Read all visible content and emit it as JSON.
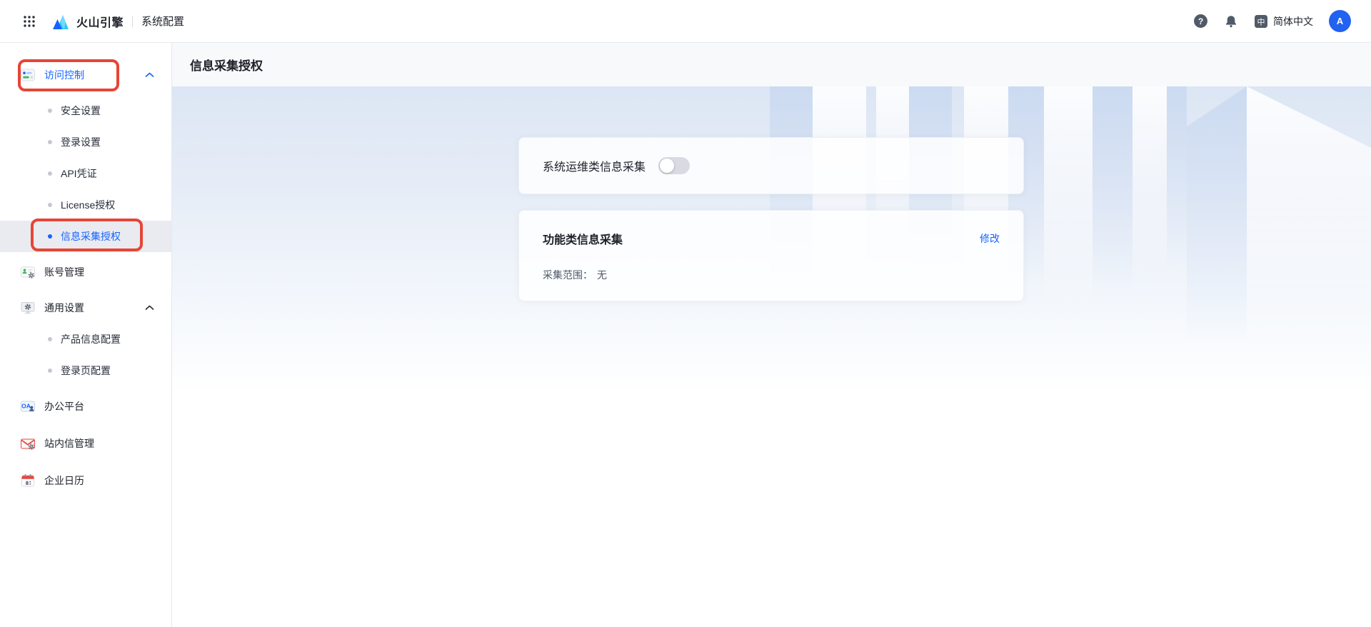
{
  "topbar": {
    "brand": "火山引擎",
    "app_title": "系统配置",
    "language": "简体中文",
    "avatar_letter": "A"
  },
  "sidebar": {
    "items": [
      {
        "label": "访问控制",
        "type": "group",
        "state": "active-expanded",
        "annotated": true
      },
      {
        "label": "安全设置",
        "type": "sub"
      },
      {
        "label": "登录设置",
        "type": "sub"
      },
      {
        "label": "API凭证",
        "type": "sub"
      },
      {
        "label": "License授权",
        "type": "sub"
      },
      {
        "label": "信息采集授权",
        "type": "sub",
        "state": "selected",
        "annotated": true
      },
      {
        "label": "账号管理",
        "type": "group"
      },
      {
        "label": "通用设置",
        "type": "group",
        "state": "expanded"
      },
      {
        "label": "产品信息配置",
        "type": "sub"
      },
      {
        "label": "登录页配置",
        "type": "sub"
      },
      {
        "label": "办公平台",
        "type": "group"
      },
      {
        "label": "站内信管理",
        "type": "group"
      },
      {
        "label": "企业日历",
        "type": "group"
      }
    ]
  },
  "page": {
    "title": "信息采集授权"
  },
  "main": {
    "cards": [
      {
        "title": "系统运维类信息采集",
        "toggle_state": "off"
      },
      {
        "title": "功能类信息采集",
        "action_label": "修改",
        "scope_label": "采集范围：",
        "scope_value": "无"
      }
    ]
  },
  "colors": {
    "accent": "#1664ff",
    "annotation_red": "#e64536",
    "topbar_icon_gray": "#515a68",
    "selected_row_bg": "#e9ebf0",
    "banner_top": "#dce6f4"
  }
}
